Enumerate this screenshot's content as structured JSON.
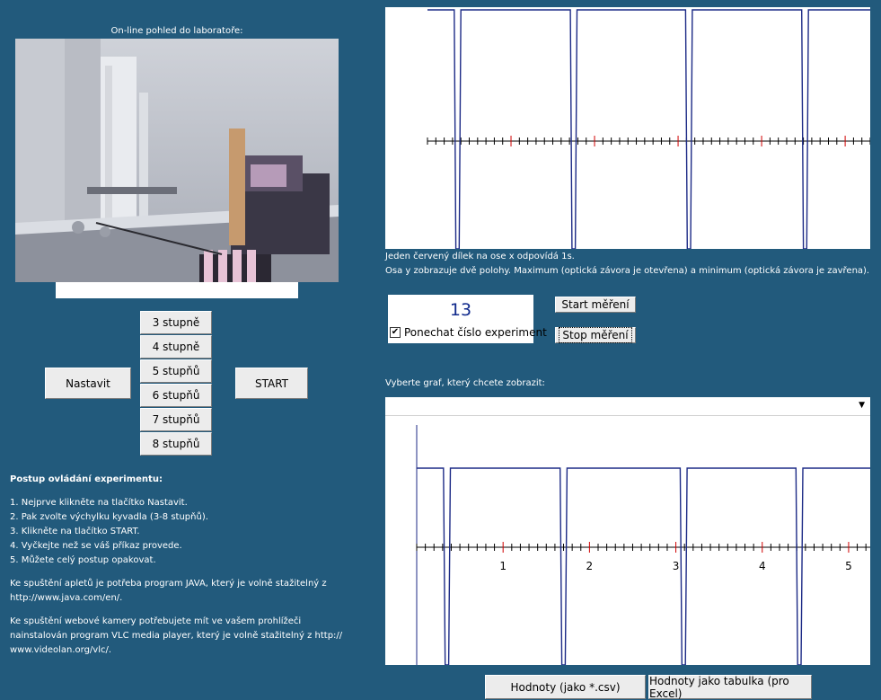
{
  "camera": {
    "label": "On-line pohled do laboratoře:"
  },
  "buttons": {
    "nastavit": "Nastavit",
    "start": "START",
    "degrees": [
      "3 stupně",
      "4 stupně",
      "5 stupňů",
      "6 stupňů",
      "7 stupňů",
      "8 stupňů"
    ],
    "start_measure": "Start měření",
    "stop_measure": "Stop měření",
    "csv": "Hodnoty (jako *.csv)",
    "excel": "Hodnoty jako tabulka (pro Excel)"
  },
  "instructions": {
    "heading": "Postup ovládání experimentu:",
    "steps": [
      "1. Nejprve klikněte na  tlačítko Nastavit.",
      "2. Pak zvolte výchylku kyvadla (3-8 stupňů).",
      "3. Klikněte na  tlačítko START.",
      "4. Vyčkejte než se váš příkaz provede.",
      "5. Můžete celý postup opakovat."
    ],
    "java_1": "Ke spuštění apletů je potřeba program JAVA, který je volně stažitelný z",
    "java_2": "http://www.java.com/en/.",
    "vlc_1": "Ke spuštění webové kamery potřebujete mít ve vašem prohlížeči",
    "vlc_2": "nainstalován program VLC media player, který je volně stažitelný z http://",
    "vlc_3": "www.videolan.org/vlc/."
  },
  "info": {
    "line1": "Jeden červený dílek na ose x odpovídá 1s.",
    "line2": "Osa y zobrazuje dvě polohy. Maximum (optická závora je otevřena) a minimum (optická závora je zavřena)."
  },
  "counter": {
    "value": "13",
    "checked": true,
    "checkbox_label": "Ponechat číslo experiment"
  },
  "graph_select": {
    "label": "Vyberte graf, který chcete zobrazit:",
    "selected": ""
  },
  "colors": {
    "background": "#225a7c",
    "signal": "#1c2a86",
    "tick_red": "#d00000",
    "tick_black": "#000000"
  },
  "chart_data": [
    {
      "type": "line",
      "description_visible": false,
      "x_unit_s_per_red_tick": 1,
      "x": [
        0.0,
        0.32,
        0.34,
        0.36,
        0.38,
        0.4,
        1.71,
        1.73,
        1.75,
        1.77,
        1.79,
        3.09,
        3.11,
        3.13,
        3.15,
        3.17,
        4.48,
        4.5,
        4.52,
        4.54,
        4.56,
        5.3
      ],
      "y": [
        1,
        1,
        0,
        0,
        0,
        1,
        1,
        0,
        0,
        0,
        1,
        1,
        0,
        0,
        0,
        1,
        1,
        0,
        0,
        0,
        1,
        1
      ],
      "xlim": [
        0,
        5.3
      ],
      "ylim": [
        0,
        1
      ]
    },
    {
      "type": "line",
      "x": [
        0.0,
        0.31,
        0.33,
        0.35,
        0.37,
        0.39,
        1.66,
        1.68,
        1.7,
        1.72,
        1.74,
        3.05,
        3.07,
        3.09,
        3.11,
        3.13,
        4.39,
        4.41,
        4.43,
        4.45,
        4.47,
        5.25
      ],
      "y": [
        1,
        1,
        0,
        0,
        0,
        1,
        1,
        0,
        0,
        0,
        1,
        1,
        0,
        0,
        0,
        1,
        1,
        0,
        0,
        0,
        1,
        1
      ],
      "xlim": [
        0,
        5.25
      ],
      "ylim": [
        0,
        1
      ],
      "tick_labels": [
        "1",
        "2",
        "3",
        "4",
        "5"
      ]
    }
  ]
}
